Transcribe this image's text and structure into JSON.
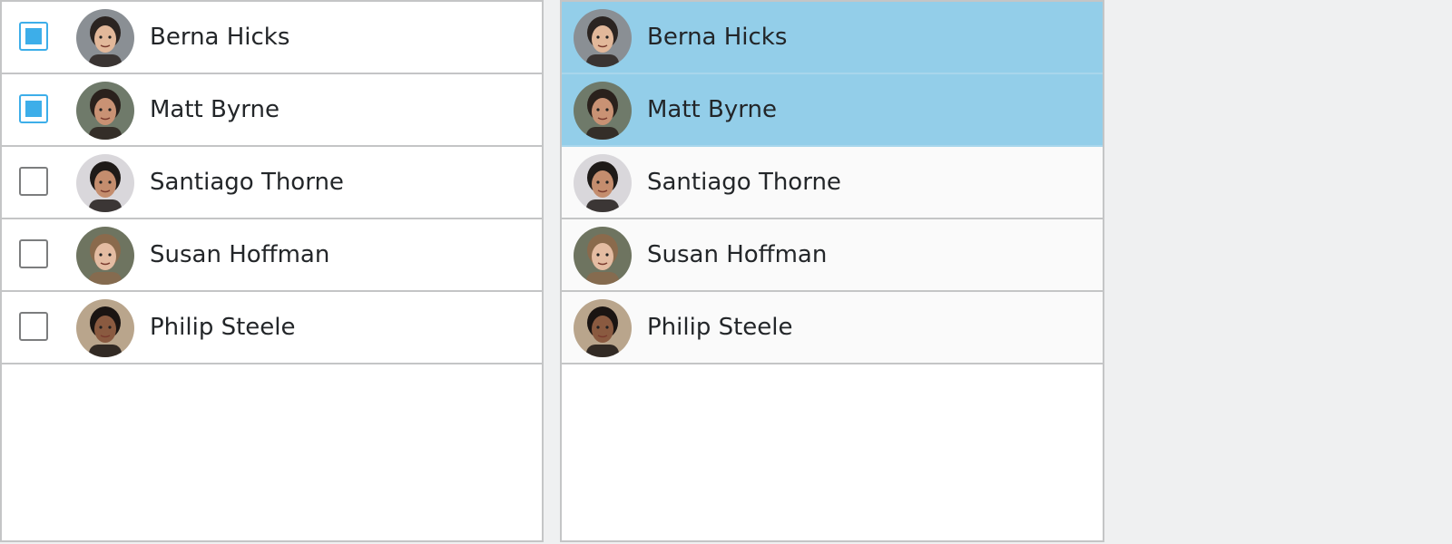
{
  "left_list": {
    "items": [
      {
        "name": "Berna Hicks",
        "checked": true
      },
      {
        "name": "Matt Byrne",
        "checked": true
      },
      {
        "name": "Santiago Thorne",
        "checked": false
      },
      {
        "name": "Susan Hoffman",
        "checked": false
      },
      {
        "name": "Philip Steele",
        "checked": false
      }
    ]
  },
  "right_list": {
    "items": [
      {
        "name": "Berna Hicks",
        "selected": true
      },
      {
        "name": "Matt Byrne",
        "selected": true
      },
      {
        "name": "Santiago Thorne",
        "selected": false
      },
      {
        "name": "Susan Hoffman",
        "selected": false
      },
      {
        "name": "Philip Steele",
        "selected": false
      }
    ]
  },
  "colors": {
    "window_bg": "#eff0f1",
    "accent": "#3daee9",
    "selection_bg": "#93cee9",
    "row_border": "#c4c5c6",
    "text": "#232629"
  },
  "avatars": [
    {
      "icon": "avatar-photo-woman-glasses",
      "bg": "#8a8f94",
      "skin": "#e2b89a",
      "hair": "#2b2421"
    },
    {
      "icon": "avatar-photo-man-beard",
      "bg": "#6f7a6a",
      "skin": "#c99274",
      "hair": "#2a211c"
    },
    {
      "icon": "avatar-photo-man-glasses-beard",
      "bg": "#d9d7db",
      "skin": "#c48d6e",
      "hair": "#1e1a18"
    },
    {
      "icon": "avatar-photo-woman-long-hair",
      "bg": "#6e7460",
      "skin": "#e4bca2",
      "hair": "#8a6a4c"
    },
    {
      "icon": "avatar-photo-man-curly-hair",
      "bg": "#b9a58c",
      "skin": "#8a5a40",
      "hair": "#1a1412"
    }
  ]
}
